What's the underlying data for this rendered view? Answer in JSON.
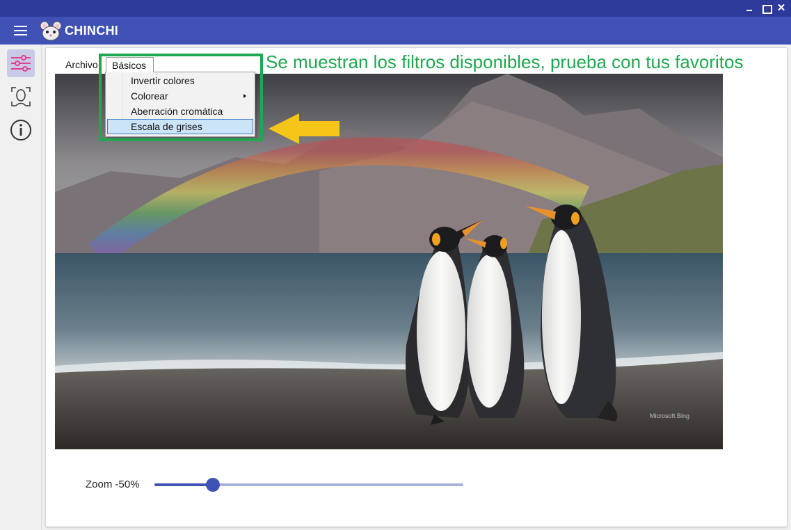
{
  "window": {
    "close_glyph": "✕"
  },
  "app": {
    "title": "CHINCHI",
    "logo": "chinchilla-logo",
    "accent": "#3f51b5",
    "titlebar_color": "#2e3a9a"
  },
  "sidebar": {
    "items": [
      {
        "icon": "sliders-icon",
        "active": true
      },
      {
        "icon": "face-scan-icon",
        "active": false
      },
      {
        "icon": "info-icon",
        "active": false
      }
    ]
  },
  "menu": {
    "archivo": "Archivo",
    "basicos": "Básicos",
    "dropdown": [
      {
        "label": "Invertir colores",
        "submenu": false,
        "selected": false
      },
      {
        "label": "Colorear",
        "submenu": true,
        "selected": false
      },
      {
        "label": "Aberración cromática",
        "submenu": false,
        "selected": false
      },
      {
        "label": "Escala de grises",
        "submenu": false,
        "selected": true
      }
    ]
  },
  "image": {
    "watermark": "Microsoft Bing"
  },
  "annotation": {
    "text": "Se muestran los filtros disponibles, prueba con tus favoritos",
    "color": "#1fa84f",
    "arrow_color": "#f5c518"
  },
  "zoom": {
    "label": "Zoom -50%",
    "value_fraction": 0.19
  }
}
